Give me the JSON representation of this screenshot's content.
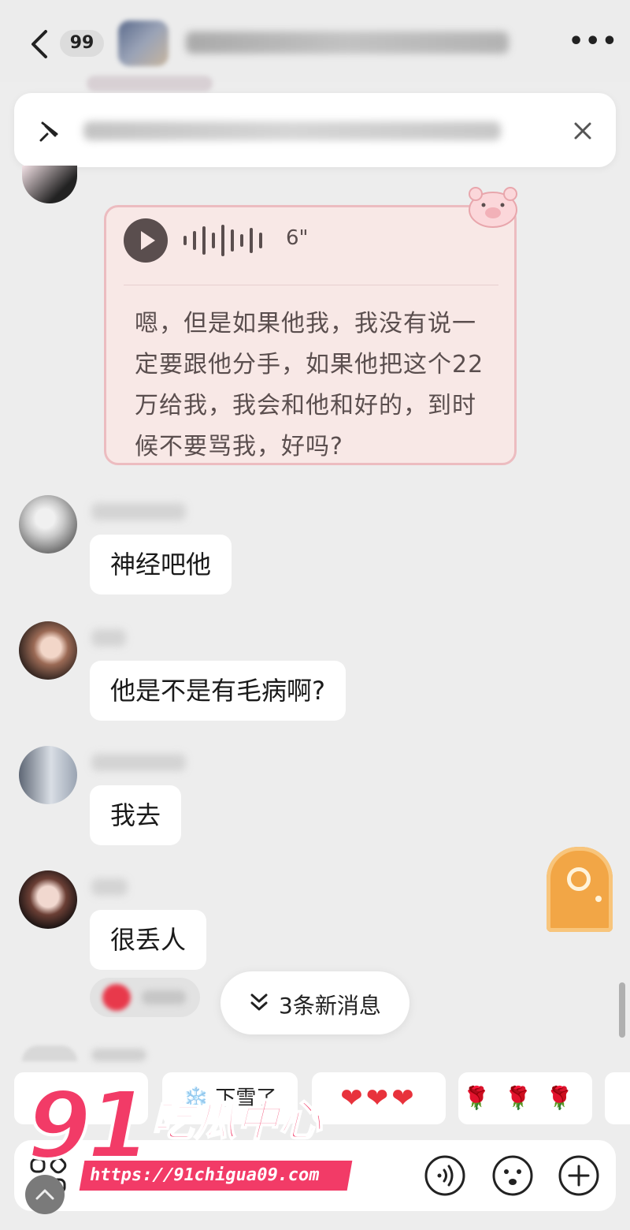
{
  "header": {
    "unread_count": "99"
  },
  "voice_message": {
    "duration": "6\"",
    "transcript": "嗯，但是如果他我，我没有说一定要跟他分手，如果他把这个22万给我，我会和他和好的，到时候不要骂我，好吗?"
  },
  "messages": [
    {
      "text": "神经吧他"
    },
    {
      "text": "他是不是有毛病啊?"
    },
    {
      "text": "我去"
    },
    {
      "text": "很丢人"
    }
  ],
  "new_messages_label": "3条新消息",
  "quick_replies": [
    {
      "label": "下雪了",
      "prefix": "❄️"
    },
    {
      "label": "❤❤❤"
    },
    {
      "label": "🌹🌹🌹"
    }
  ],
  "watermark": {
    "number": "91",
    "brand": "吃瓜中心",
    "url": "https://91chigua09.com"
  },
  "colors": {
    "voice_card_bg": "#f8e8e6",
    "voice_card_border": "#ecbcc0",
    "watermark_pink": "#f23b67"
  }
}
